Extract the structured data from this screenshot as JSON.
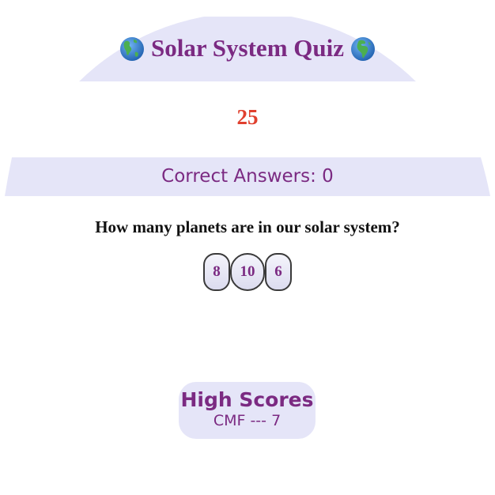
{
  "header": {
    "title": "Solar System Quiz",
    "left_icon": "earth-globe-americas",
    "right_icon": "earth-globe-africa-europe"
  },
  "timer": {
    "value": "25"
  },
  "score": {
    "label": "Correct Answers: 0"
  },
  "question": {
    "text": "How many planets are in our solar system?",
    "answers": [
      "8",
      "10",
      "6"
    ]
  },
  "highscores": {
    "title": "High Scores",
    "entries": [
      "CMF --- 7"
    ]
  },
  "colors": {
    "accent_purple": "#7b2a82",
    "panel_lavender": "#e5e5f8",
    "timer_red": "#e0402e"
  }
}
